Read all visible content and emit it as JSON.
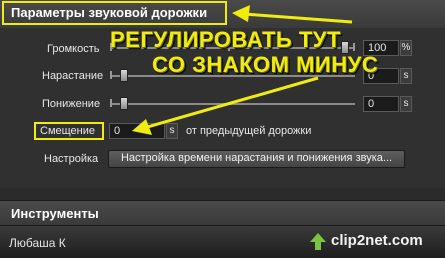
{
  "panel": {
    "title": "Параметры звуковой дорожки"
  },
  "controls": {
    "volume": {
      "label": "Громкость",
      "value": "100",
      "unit": "%",
      "level": 1.0
    },
    "fade_in": {
      "label": "Нарастание",
      "value": "0",
      "unit": "s",
      "level": 0.0
    },
    "fade_out": {
      "label": "Понижение",
      "value": "0",
      "unit": "s",
      "level": 0.0
    },
    "offset": {
      "label": "Смещение",
      "value": "0",
      "unit": "s",
      "suffix": "от предыдущей дорожки"
    },
    "setup": {
      "label": "Настройка",
      "button": "Настройка времени нарастания и понижения звука..."
    }
  },
  "annotation": {
    "line1": "РЕГУЛИРОВАТЬ ТУТ",
    "line2": "СО ЗНАКОМ МИНУС",
    "color": "#f0ec10"
  },
  "tools": {
    "title": "Инструменты"
  },
  "footer": {
    "user": "Любаша К",
    "watermark": "clip2net.com"
  },
  "colors": {
    "background": "#2b2b2b",
    "highlight": "#f0ec10",
    "watermark_green": "#7cc243"
  }
}
